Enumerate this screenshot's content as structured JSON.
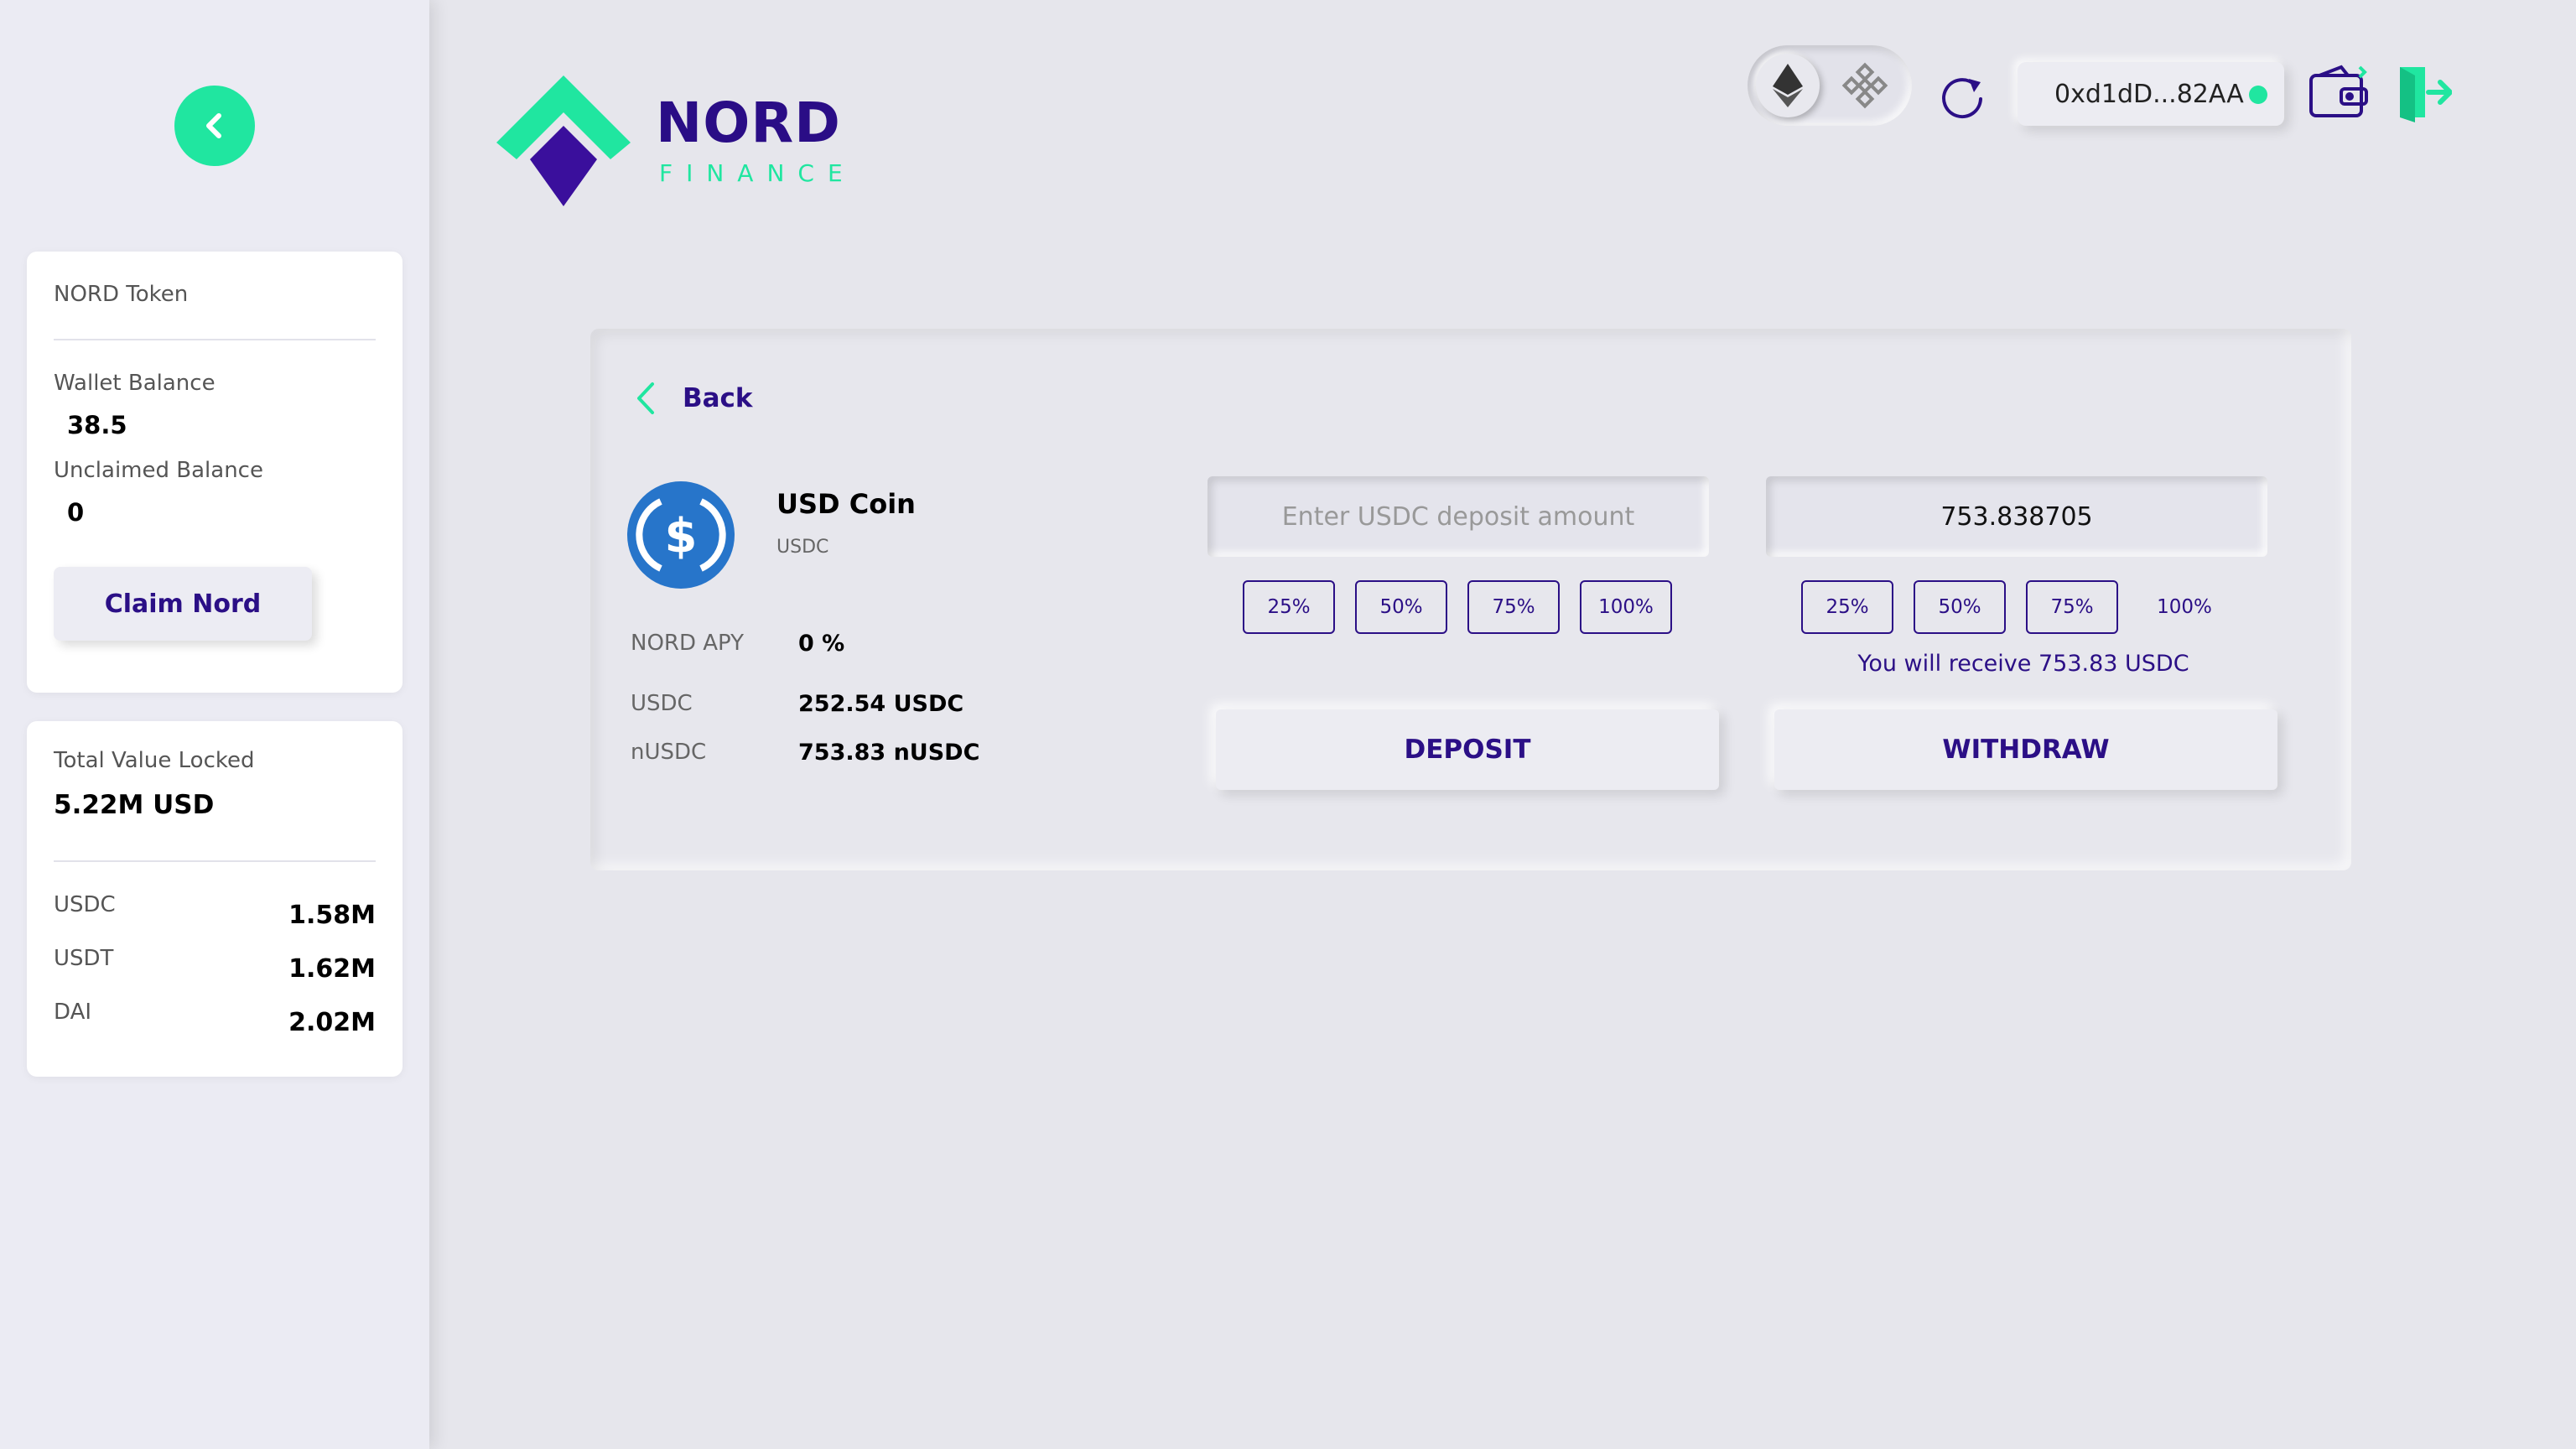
{
  "sidebar": {
    "token_card": {
      "title": "NORD Token",
      "wallet_balance_label": "Wallet Balance",
      "wallet_balance_value": "38.5",
      "unclaimed_balance_label": "Unclaimed Balance",
      "unclaimed_balance_value": "0",
      "claim_button": "Claim Nord"
    },
    "tvl_card": {
      "title": "Total Value Locked",
      "total": "5.22M USD",
      "rows": [
        {
          "label": "USDC",
          "value": "1.58M"
        },
        {
          "label": "USDT",
          "value": "1.62M"
        },
        {
          "label": "DAI",
          "value": "2.02M"
        }
      ]
    }
  },
  "header": {
    "brand": "NORD",
    "brand_sub": "FINANCE",
    "wallet_address": "0xd1dD...82AA",
    "status_color": "#20e6a0"
  },
  "panel": {
    "back_label": "Back",
    "coin": {
      "name": "USD Coin",
      "symbol": "USDC"
    },
    "stats": [
      {
        "label": "NORD APY",
        "value": "0 %"
      },
      {
        "label": "USDC",
        "value": "252.54 USDC"
      },
      {
        "label": "nUSDC",
        "value": "753.83 nUSDC"
      }
    ],
    "deposit": {
      "placeholder": "Enter USDC deposit amount",
      "value": "",
      "percentages": [
        "25%",
        "50%",
        "75%",
        "100%"
      ],
      "button": "DEPOSIT"
    },
    "withdraw": {
      "value": "753.838705",
      "percentages": [
        "25%",
        "50%",
        "75%",
        "100%"
      ],
      "receive_text": "You will receive 753.83 USDC",
      "button": "WITHDRAW"
    }
  },
  "colors": {
    "accent": "#20e6a0",
    "brand": "#2a0d86",
    "coin_blue": "#2775ca"
  }
}
